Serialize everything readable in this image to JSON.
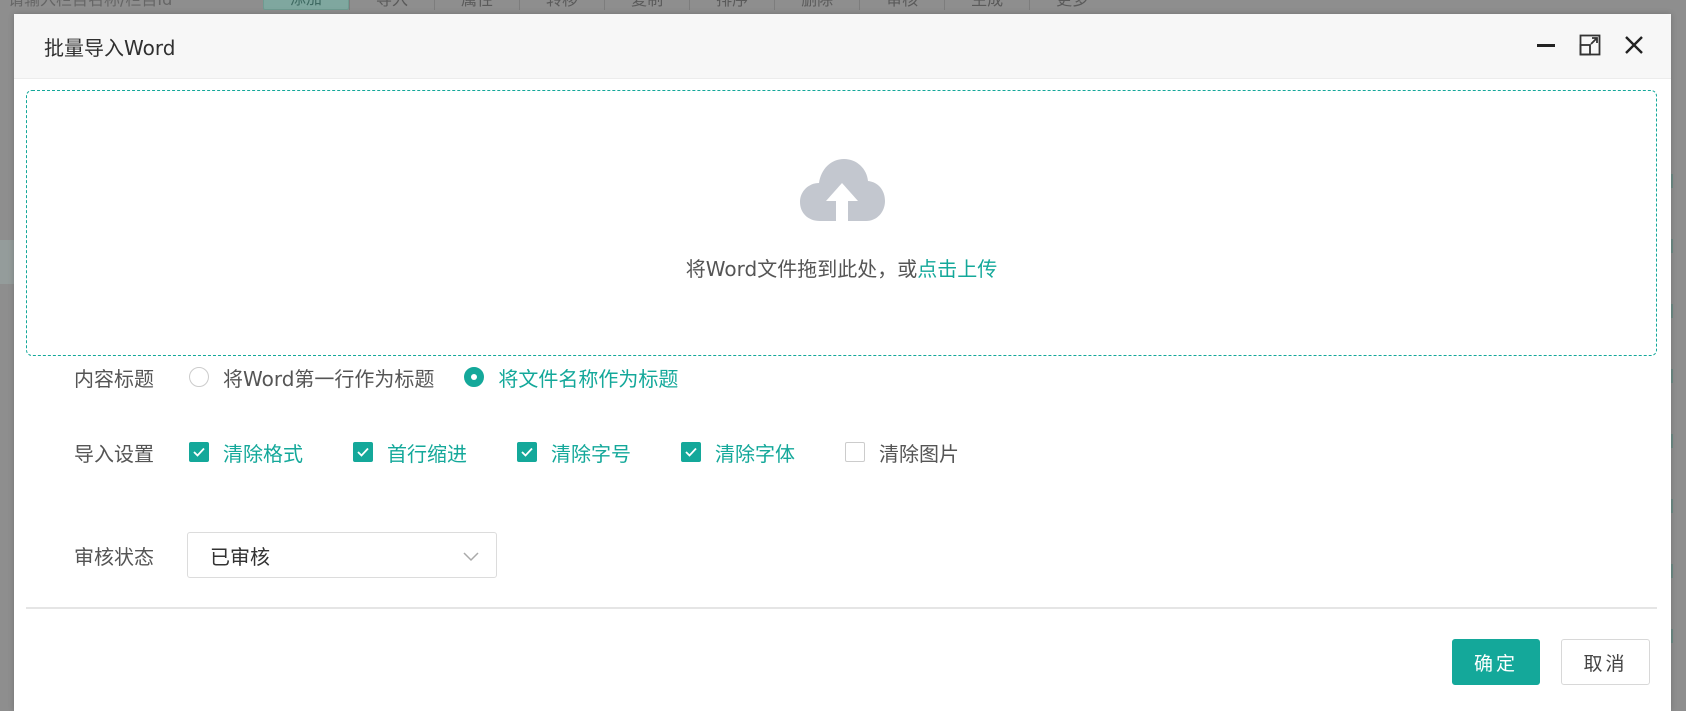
{
  "background": {
    "search_placeholder": "请输入栏目名称/栏目Id",
    "add_label": "添加",
    "toolbar": [
      "导入",
      "属性",
      "转移",
      "复制",
      "排序",
      "删除",
      "审核",
      "生成",
      "更多"
    ]
  },
  "modal": {
    "title": "批量导入Word",
    "icons": {
      "minimize": "minimize-icon",
      "maximize": "maximize-icon",
      "close": "close-icon"
    }
  },
  "upload": {
    "text": "将Word文件拖到此处，或",
    "link": "点击上传",
    "icon": "cloud-upload-icon"
  },
  "content_title": {
    "label": "内容标题",
    "options": [
      {
        "label": "将Word第一行作为标题",
        "checked": false
      },
      {
        "label": "将文件名称作为标题",
        "checked": true
      }
    ]
  },
  "import_settings": {
    "label": "导入设置",
    "options": [
      {
        "label": "清除格式",
        "checked": true
      },
      {
        "label": "首行缩进",
        "checked": true
      },
      {
        "label": "清除字号",
        "checked": true
      },
      {
        "label": "清除字体",
        "checked": true
      },
      {
        "label": "清除图片",
        "checked": false
      }
    ]
  },
  "review_status": {
    "label": "审核状态",
    "value": "已审核"
  },
  "footer": {
    "confirm": "确定",
    "cancel": "取消"
  },
  "colors": {
    "accent": "#14a89a",
    "icon_gray": "#c3c7cf"
  }
}
